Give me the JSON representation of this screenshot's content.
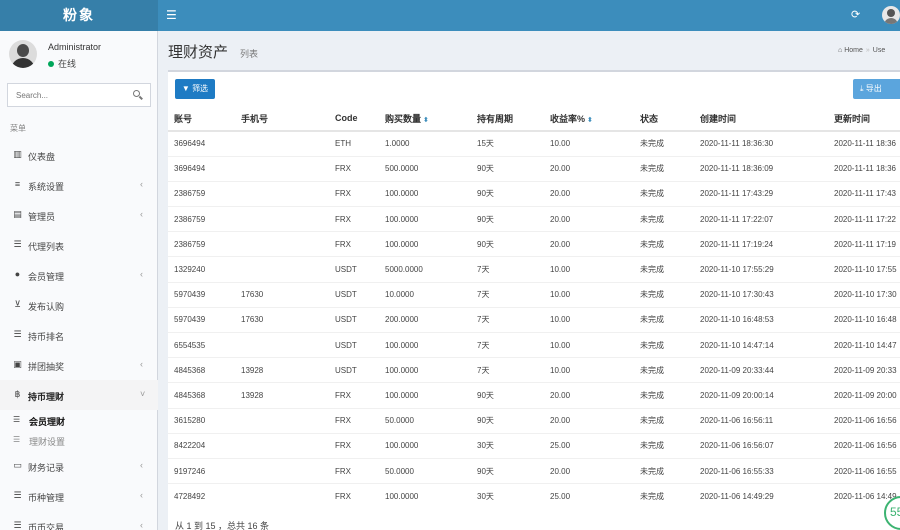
{
  "app": {
    "logo": "粉象"
  },
  "user": {
    "name": "Administrator",
    "status": "在线"
  },
  "search": {
    "placeholder": "Search..."
  },
  "menu": {
    "header": "菜单",
    "items": [
      {
        "label": "仪表盘",
        "icon": "bar-chart-icon",
        "glyph": "▥"
      },
      {
        "label": "系统设置",
        "icon": "sliders-icon",
        "glyph": "≡",
        "chevron": "‹"
      },
      {
        "label": "管理员",
        "icon": "server-icon",
        "glyph": "▤",
        "chevron": "‹"
      },
      {
        "label": "代理列表",
        "icon": "list-icon",
        "glyph": "☰"
      },
      {
        "label": "会员管理",
        "icon": "users-icon",
        "glyph": "●",
        "chevron": "‹"
      },
      {
        "label": "发布认购",
        "icon": "cart-icon",
        "glyph": "⊻"
      },
      {
        "label": "持币排名",
        "icon": "list-icon",
        "glyph": "☰"
      },
      {
        "label": "拼团抽奖",
        "icon": "gift-icon",
        "glyph": "▣",
        "chevron": "‹"
      },
      {
        "label": "持币理财",
        "icon": "bitcoin-icon",
        "glyph": "฿",
        "chevron": "˅"
      },
      {
        "label": "财务记录",
        "icon": "money-icon",
        "glyph": "▭",
        "chevron": "‹"
      },
      {
        "label": "币种管理",
        "icon": "list-icon",
        "glyph": "☰",
        "chevron": "‹"
      },
      {
        "label": "币币交易",
        "icon": "list-icon",
        "glyph": "☰",
        "chevron": "‹"
      }
    ],
    "subitems": [
      {
        "label": "会员理财",
        "glyph": "☰"
      },
      {
        "label": "理财设置",
        "glyph": "☰"
      }
    ]
  },
  "page": {
    "title": "理财资产",
    "subtitle": "列表"
  },
  "breadcrumb": {
    "home": "Home",
    "current": "Use"
  },
  "toolbar": {
    "filter": "▼ 筛选",
    "export": "⤓ 导出"
  },
  "table": {
    "columns": [
      "账号",
      "手机号",
      "Code",
      "购买数量",
      "持有周期",
      "收益率%",
      "状态",
      "创建时间",
      "更新时间"
    ],
    "rows": [
      [
        "3696494",
        "",
        "ETH",
        "1.0000",
        "15天",
        "10.00",
        "未完成",
        "2020-11-11 18:36:30",
        "2020-11-11 18:36"
      ],
      [
        "3696494",
        "",
        "FRX",
        "500.0000",
        "90天",
        "20.00",
        "未完成",
        "2020-11-11 18:36:09",
        "2020-11-11 18:36"
      ],
      [
        "2386759",
        "",
        "FRX",
        "100.0000",
        "90天",
        "20.00",
        "未完成",
        "2020-11-11 17:43:29",
        "2020-11-11 17:43"
      ],
      [
        "2386759",
        "",
        "FRX",
        "100.0000",
        "90天",
        "20.00",
        "未完成",
        "2020-11-11 17:22:07",
        "2020-11-11 17:22"
      ],
      [
        "2386759",
        "",
        "FRX",
        "100.0000",
        "90天",
        "20.00",
        "未完成",
        "2020-11-11 17:19:24",
        "2020-11-11 17:19"
      ],
      [
        "1329240",
        "",
        "USDT",
        "5000.0000",
        "7天",
        "10.00",
        "未完成",
        "2020-11-10 17:55:29",
        "2020-11-10 17:55"
      ],
      [
        "5970439",
        "17630",
        "USDT",
        "10.0000",
        "7天",
        "10.00",
        "未完成",
        "2020-11-10 17:30:43",
        "2020-11-10 17:30"
      ],
      [
        "5970439",
        "17630",
        "USDT",
        "200.0000",
        "7天",
        "10.00",
        "未完成",
        "2020-11-10 16:48:53",
        "2020-11-10 16:48"
      ],
      [
        "6554535",
        "",
        "USDT",
        "100.0000",
        "7天",
        "10.00",
        "未完成",
        "2020-11-10 14:47:14",
        "2020-11-10 14:47"
      ],
      [
        "4845368",
        "13928",
        "USDT",
        "100.0000",
        "7天",
        "10.00",
        "未完成",
        "2020-11-09 20:33:44",
        "2020-11-09 20:33"
      ],
      [
        "4845368",
        "13928",
        "FRX",
        "100.0000",
        "90天",
        "20.00",
        "未完成",
        "2020-11-09 20:00:14",
        "2020-11-09 20:00"
      ],
      [
        "3615280",
        "",
        "FRX",
        "50.0000",
        "90天",
        "20.00",
        "未完成",
        "2020-11-06 16:56:11",
        "2020-11-06 16:56"
      ],
      [
        "8422204",
        "",
        "FRX",
        "100.0000",
        "30天",
        "25.00",
        "未完成",
        "2020-11-06 16:56:07",
        "2020-11-06 16:56"
      ],
      [
        "9197246",
        "",
        "FRX",
        "50.0000",
        "90天",
        "20.00",
        "未完成",
        "2020-11-06 16:55:33",
        "2020-11-06 16:55"
      ],
      [
        "4728492",
        "",
        "FRX",
        "100.0000",
        "30天",
        "25.00",
        "未完成",
        "2020-11-06 14:49:29",
        "2020-11-06 14:49"
      ]
    ]
  },
  "pagination": {
    "info": "从 1 到 15 ，总共 16 条"
  },
  "badge": {
    "value": "55"
  },
  "colors": {
    "topbar": "#3c8dbc",
    "primary_button": "#1e7bc4"
  }
}
